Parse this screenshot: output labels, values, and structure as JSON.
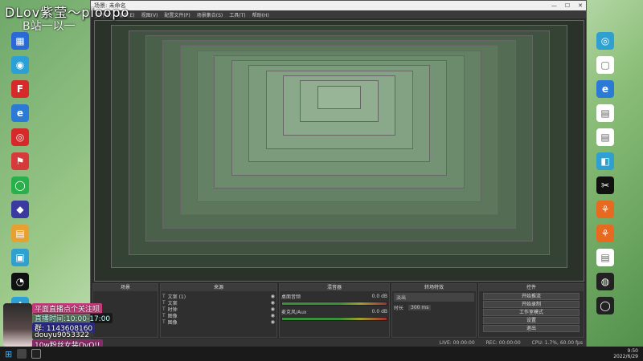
{
  "overlay": {
    "title": "DLov紫莹～ploopo",
    "subtitle": "B站一以一"
  },
  "desktop_left": [
    {
      "label": "",
      "color": "#2a6ad6",
      "icon": "▦"
    },
    {
      "label": "",
      "color": "#2aa0d6",
      "icon": "◉"
    },
    {
      "label": "",
      "color": "#d62a2a",
      "icon": "F"
    },
    {
      "label": "",
      "color": "#2a7ad6",
      "icon": "e"
    },
    {
      "label": "",
      "color": "#d62a2a",
      "icon": "◎"
    },
    {
      "label": "",
      "color": "#d63a3a",
      "icon": "⚑"
    },
    {
      "label": "",
      "color": "#2ab04a",
      "icon": "◯"
    },
    {
      "label": "",
      "color": "#3a3aa0",
      "icon": "◆"
    },
    {
      "label": "",
      "color": "#e8a030",
      "icon": "▤"
    },
    {
      "label": "",
      "color": "#30a0d0",
      "icon": "▣"
    },
    {
      "label": "",
      "color": "#111",
      "icon": "◔"
    },
    {
      "label": "",
      "color": "#2aa0d6",
      "icon": "✚"
    }
  ],
  "desktop_right": [
    {
      "label": "",
      "color": "#30a0d0",
      "icon": "◎"
    },
    {
      "label": "",
      "color": "#fff",
      "icon": "▢"
    },
    {
      "label": "",
      "color": "#2a7ad6",
      "icon": "e"
    },
    {
      "label": "",
      "color": "#fff",
      "icon": "▤"
    },
    {
      "label": "",
      "color": "#fff",
      "icon": "▤"
    },
    {
      "label": "",
      "color": "#30a0d0",
      "icon": "◧"
    },
    {
      "label": "",
      "color": "#111",
      "icon": "✂"
    },
    {
      "label": "",
      "color": "#e86a20",
      "icon": "⚘"
    },
    {
      "label": "",
      "color": "#e86a20",
      "icon": "⚘"
    },
    {
      "label": "",
      "color": "#fff",
      "icon": "▤"
    },
    {
      "label": "",
      "color": "#222",
      "icon": "◍"
    },
    {
      "label": "",
      "color": "#222",
      "icon": "◯"
    }
  ],
  "obs": {
    "title": "场景: 未命名",
    "menu": [
      "文件(F)",
      "编辑(E)",
      "视图(V)",
      "配置文件(P)",
      "场景集合(S)",
      "工具(T)",
      "帮助(H)"
    ],
    "docks": {
      "scenes": {
        "title": "场景"
      },
      "sources": {
        "title": "来源",
        "items": [
          "文案 (1)",
          "文案",
          "时钟",
          "图像",
          "图像"
        ]
      },
      "mixer": {
        "title": "混音器",
        "tracks": [
          {
            "name": "桌面音频",
            "db": "0.0 dB"
          },
          {
            "name": "麦克风/Aux",
            "db": "0.0 dB"
          }
        ]
      },
      "transitions": {
        "title": "转场特效",
        "type": "淡出",
        "duration_label": "时长",
        "duration": "300 ms"
      },
      "controls": {
        "title": "控件",
        "buttons": [
          "开始推流",
          "开始录制",
          "工作室模式",
          "设置",
          "退出"
        ]
      }
    },
    "status": [
      "LIVE: 00:00:00",
      "REC: 00:00:00",
      "CPU: 1.7%, 60.00 fps"
    ]
  },
  "streamer": {
    "line1": "直播时间:10:00-17:00",
    "line2": "群: 1143608160",
    "line3": "douyu9053322",
    "line4": "10w粉丝女装QvQ!!",
    "banner": "平面直播点个关注呗"
  },
  "taskbar": {
    "time": "9:50",
    "date": "2022/6/29"
  }
}
